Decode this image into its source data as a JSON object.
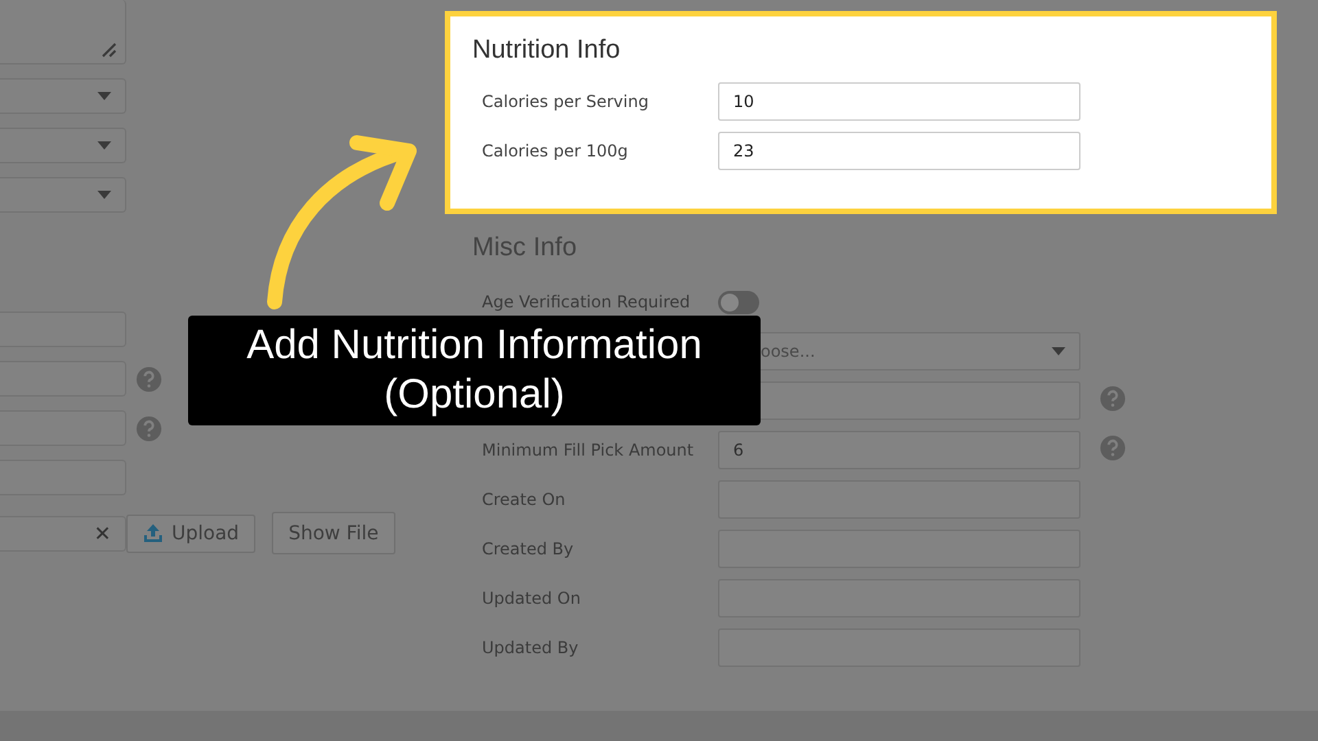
{
  "left_form": {
    "fields": [
      {
        "kind": "textarea",
        "help": false
      },
      {
        "kind": "select",
        "help": false
      },
      {
        "kind": "select",
        "help": false
      },
      {
        "kind": "select",
        "help": false
      },
      {
        "kind": "input",
        "help": false
      },
      {
        "kind": "input",
        "help": true
      },
      {
        "kind": "input",
        "help": true
      },
      {
        "kind": "input",
        "help": false
      },
      {
        "kind": "file",
        "help": false,
        "clear": "✕",
        "buttons": [
          "Upload",
          "Show File"
        ]
      }
    ]
  },
  "nutrition_info": {
    "title": "Nutrition Info",
    "highlighted": true,
    "fields": [
      {
        "label": "Calories per Serving",
        "value": "10"
      },
      {
        "label": "Calories per 100g",
        "value": "23"
      }
    ]
  },
  "misc_info": {
    "title": "Misc Info",
    "fields": [
      {
        "kind": "toggle",
        "label": "Age Verification Required",
        "on": false,
        "help": false
      },
      {
        "kind": "select",
        "placeholder": "oose...",
        "help": false
      },
      {
        "kind": "input",
        "help": true
      },
      {
        "kind": "input",
        "label": "Minimum Fill Pick Amount",
        "value": "6",
        "help": true
      },
      {
        "kind": "input",
        "label": "Create On",
        "help": false
      },
      {
        "kind": "input",
        "label": "Created By",
        "help": false
      },
      {
        "kind": "input",
        "label": "Updated On",
        "help": false
      },
      {
        "kind": "input",
        "label": "Updated By",
        "help": false
      }
    ]
  },
  "callout": {
    "text": "Add Nutrition Information (Optional)"
  }
}
